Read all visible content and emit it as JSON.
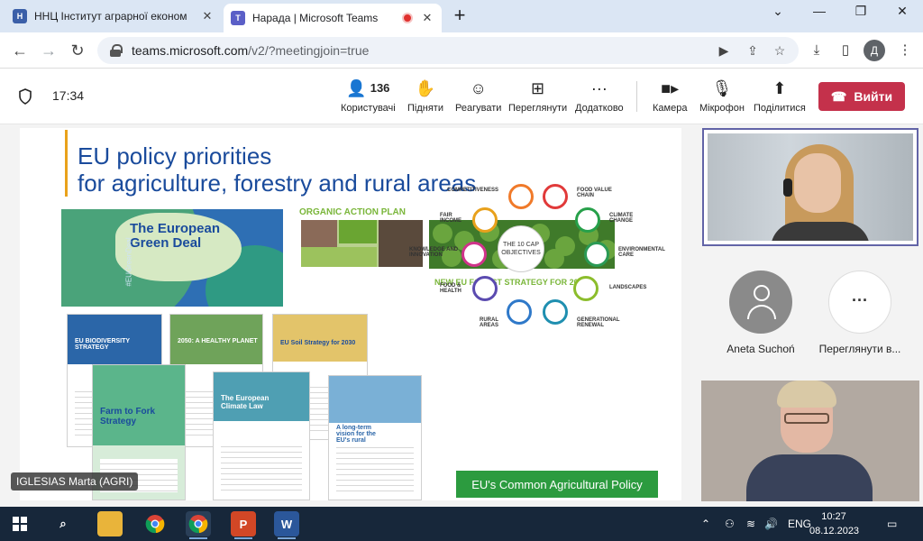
{
  "browser": {
    "tabs": [
      {
        "title": "ННЦ Інститут аграрної економ",
        "active": false,
        "favicon": "university-icon"
      },
      {
        "title": "Нарада | Microsoft Teams",
        "active": true,
        "favicon": "teams-icon",
        "recording": true
      }
    ],
    "url_host": "teams.microsoft.com",
    "url_path": "/v2/?meetingjoin=true",
    "profile_initial": "Д"
  },
  "meeting": {
    "time": "17:34",
    "controls": {
      "people": {
        "count": "136",
        "label": "Користувачі"
      },
      "raise": {
        "label": "Підняти"
      },
      "react": {
        "label": "Реагувати"
      },
      "view": {
        "label": "Переглянути"
      },
      "more": {
        "label": "Додатково"
      },
      "camera": {
        "label": "Камера"
      },
      "mic": {
        "label": "Мікрофон"
      },
      "share": {
        "label": "Поділитися"
      }
    },
    "leave_label": "Вийти",
    "presenter_tag": "IGLESIAS Marta (AGRI)"
  },
  "slide": {
    "title_line1": "EU policy priorities",
    "title_line2": "for agriculture, forestry and rural areas",
    "green_deal": "The European Green Deal",
    "green_deal_tag": "#EUGreenDeal",
    "organic": "ORGANIC ACTION PLAN",
    "forest": "NEW EU FOREST STRATEGY FOR 2030",
    "docs": {
      "biodiversity": "EU BIODIVERSITY STRATEGY",
      "healthy_planet": "2050: A HEALTHY PLANET",
      "soil": "EU Soil Strategy for 2030",
      "farm_to_fork": "Farm to Fork Strategy",
      "climate_law": "The European Climate Law",
      "rural": "A long-term vision for the EU's rural areas"
    },
    "cap": {
      "center": "THE 10 CAP OBJECTIVES",
      "labels": [
        "COMPETITIVENESS",
        "FOOD VALUE CHAIN",
        "CLIMATE CHANGE",
        "ENVIRONMENTAL CARE",
        "LANDSCAPES",
        "GENERATIONAL RENEWAL",
        "RURAL AREAS",
        "FOOD & HEALTH",
        "KNOWLEDGE AND INNOVATION",
        "FAIR INCOME"
      ],
      "banner": "EU's Common Agricultural Policy"
    }
  },
  "participants": [
    {
      "name": "Aneta Suchoń"
    },
    {
      "name": "Переглянути в..."
    }
  ],
  "taskbar": {
    "lang": "ENG",
    "time": "10:27",
    "date": "08.12.2023"
  },
  "colors": {
    "teams_purple": "#6264a7",
    "leave_red": "#c4314b",
    "slide_blue": "#1a4b9c",
    "cap_green": "#2c9b3f"
  }
}
